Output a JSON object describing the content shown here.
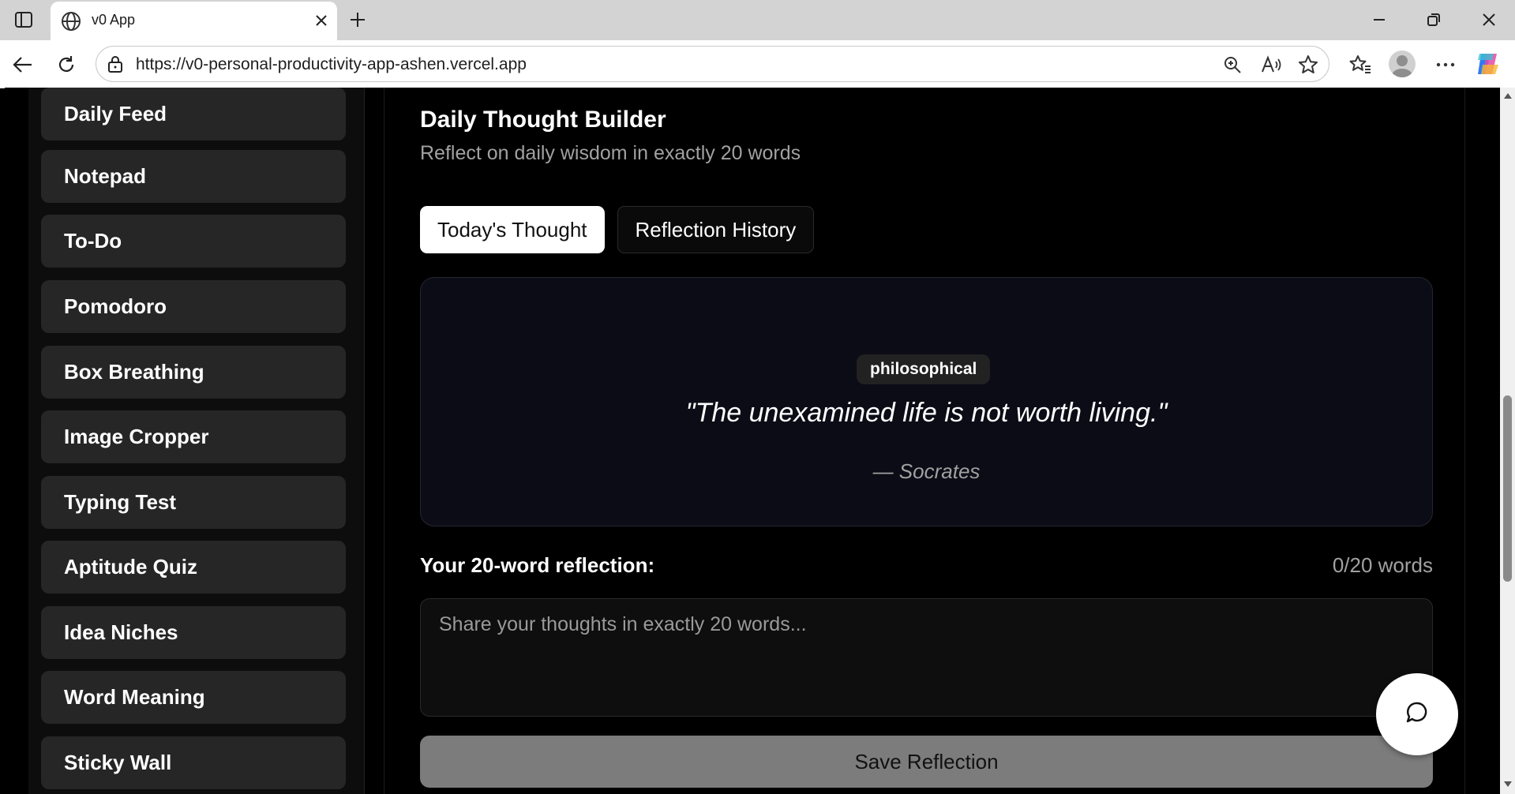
{
  "browser": {
    "tab_title": "v0 App",
    "url": "https://v0-personal-productivity-app-ashen.vercel.app"
  },
  "sidebar": {
    "items": [
      {
        "label": "Daily Feed"
      },
      {
        "label": "Notepad"
      },
      {
        "label": "To-Do"
      },
      {
        "label": "Pomodoro"
      },
      {
        "label": "Box Breathing"
      },
      {
        "label": "Image Cropper"
      },
      {
        "label": "Typing Test"
      },
      {
        "label": "Aptitude Quiz"
      },
      {
        "label": "Idea Niches"
      },
      {
        "label": "Word Meaning"
      },
      {
        "label": "Sticky Wall"
      }
    ]
  },
  "main": {
    "title": "Daily Thought Builder",
    "subtitle": "Reflect on daily wisdom in exactly 20 words",
    "tabs": [
      {
        "label": "Today's Thought",
        "active": true
      },
      {
        "label": "Reflection History",
        "active": false
      }
    ],
    "quote": {
      "category": "philosophical",
      "text": "\"The unexamined life is not worth living.\"",
      "author": "— Socrates"
    },
    "reflection": {
      "label": "Your 20-word reflection:",
      "word_count": "0/20 words",
      "placeholder": "Share your thoughts in exactly 20 words...",
      "value": ""
    },
    "save_label": "Save Reflection"
  },
  "colors": {
    "background": "#000000",
    "sidebar_item": "#262626",
    "card": "#0b0c16",
    "save_button": "#7c7c7c"
  }
}
